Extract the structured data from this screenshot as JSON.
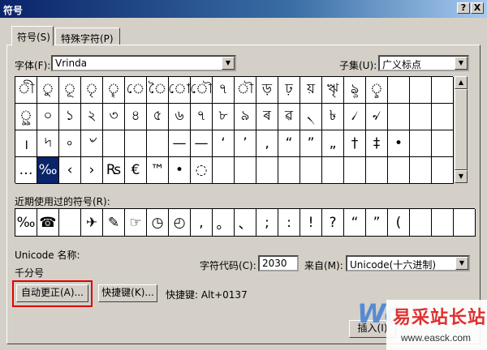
{
  "window": {
    "title": "符号",
    "help_button": "?",
    "close_button": "X"
  },
  "tabs": [
    {
      "label": "符号(S)"
    },
    {
      "label": "特殊字符(P)"
    }
  ],
  "font": {
    "label": "字体(F):",
    "value": "Vrinda"
  },
  "subset": {
    "label": "子集(U):",
    "value": "广义标点"
  },
  "symbol_grid": [
    [
      "ী",
      "ু",
      "ূ",
      "ৃ",
      "ৄ",
      "ে",
      "ৈ",
      "ো",
      "ৌ",
      "৭",
      "ৗ",
      "ড়",
      "ঢ়",
      "য়",
      "ৠ",
      "ৡ",
      "ৢ",
      "",
      "",
      ""
    ],
    [
      "ৣ",
      "০",
      "১",
      "২",
      "৩",
      "৪",
      "৫",
      "৬",
      "৭",
      "৮",
      "৯",
      "ৰ",
      "ৱ",
      "৲",
      "৳",
      "৴",
      "৵",
      "",
      "",
      ""
    ],
    [
      "।",
      "৸",
      "৹",
      "৺",
      "",
      "",
      "",
      "—",
      "—",
      "‘",
      "’",
      "‚",
      "“",
      "”",
      "„",
      "†",
      "‡",
      "•",
      "",
      ""
    ],
    [
      "…",
      "‰",
      "‹",
      "›",
      "₨",
      "€",
      "™",
      "•",
      "◌",
      "",
      "",
      "",
      "",
      "",
      "",
      "",
      "",
      "",
      "",
      ""
    ]
  ],
  "selected_cell": {
    "row": 3,
    "col": 1
  },
  "recent": {
    "label": "近期使用过的符号(R):",
    "symbols": [
      "‰",
      "☎",
      "",
      "✈",
      "✎",
      "☞",
      "◷",
      "◴",
      ",",
      "。",
      "、",
      ";",
      ":",
      "!",
      "?",
      "“",
      "”",
      "(",
      "",
      "",
      ""
    ]
  },
  "unicode_name": {
    "label": "Unicode 名称:",
    "value": "千分号"
  },
  "char_code": {
    "label": "字符代码(C):",
    "value": "2030"
  },
  "from": {
    "label": "来自(M):",
    "value": "Unicode(十六进制)"
  },
  "buttons": {
    "autocorrect": "自动更正(A)...",
    "shortcut": "快捷键(K)...",
    "insert": "插入(I)"
  },
  "shortcut_text": "快捷键: Alt+0137",
  "watermark": {
    "brand_fragment": "Wo",
    "site_name": "易采站长站",
    "site_url": "www.easck.com"
  },
  "colors": {
    "title_bar": "#0a246a",
    "selection": "#0a246a",
    "highlight": "#e00000",
    "watermark": "#e03030"
  }
}
